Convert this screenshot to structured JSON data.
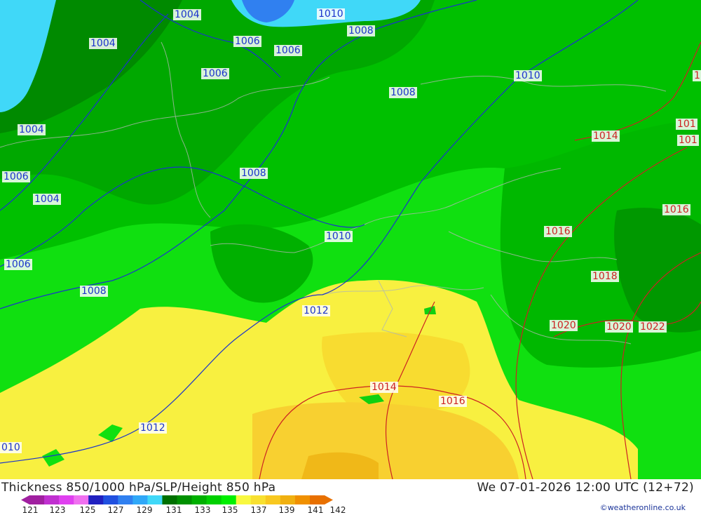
{
  "title": "Thickness 850/1000 hPa/SLP/Height 850 hPa",
  "datetime": "We 07-01-2026 12:00 UTC (12+72)",
  "credit": "©weatheronline.co.uk",
  "scale": {
    "labels": [
      "121",
      "123",
      "125",
      "127",
      "129",
      "131",
      "133",
      "135",
      "137",
      "139",
      "141",
      "142"
    ],
    "colors": [
      "#a020a0",
      "#c030d0",
      "#e040f0",
      "#f070f0",
      "#2020c0",
      "#2050e0",
      "#3080f0",
      "#30a8f8",
      "#40d8f8",
      "#007000",
      "#009000",
      "#00b000",
      "#00d000",
      "#00f000",
      "#f8f840",
      "#f8e030",
      "#f8c820",
      "#f0b010",
      "#f09000",
      "#e87000"
    ]
  },
  "isobar_labels": [
    {
      "text": "1004",
      "type": "low"
    },
    {
      "text": "1010",
      "type": "low"
    },
    {
      "text": "1008",
      "type": "low"
    },
    {
      "text": "1004",
      "type": "low"
    },
    {
      "text": "1006",
      "type": "low"
    },
    {
      "text": "1006",
      "type": "low"
    },
    {
      "text": "1006",
      "type": "low"
    },
    {
      "text": "1010",
      "type": "low"
    },
    {
      "text": "1008",
      "type": "low"
    },
    {
      "text": "1004",
      "type": "low"
    },
    {
      "text": "1008",
      "type": "low"
    },
    {
      "text": "1006",
      "type": "low"
    },
    {
      "text": "1004",
      "type": "low"
    },
    {
      "text": "1010",
      "type": "low"
    },
    {
      "text": "1006",
      "type": "low"
    },
    {
      "text": "1008",
      "type": "low"
    },
    {
      "text": "1012",
      "type": "low"
    },
    {
      "text": "1012",
      "type": "low"
    },
    {
      "text": "010",
      "type": "low"
    },
    {
      "text": "1014",
      "type": "high"
    },
    {
      "text": "101",
      "type": "high"
    },
    {
      "text": "101",
      "type": "high"
    },
    {
      "text": "1016",
      "type": "high"
    },
    {
      "text": "1016",
      "type": "high"
    },
    {
      "text": "1018",
      "type": "high"
    },
    {
      "text": "1020",
      "type": "high"
    },
    {
      "text": "1020",
      "type": "high"
    },
    {
      "text": "1022",
      "type": "high"
    },
    {
      "text": "1014",
      "type": "high"
    },
    {
      "text": "1016",
      "type": "high"
    },
    {
      "text": "1",
      "type": "high"
    }
  ]
}
